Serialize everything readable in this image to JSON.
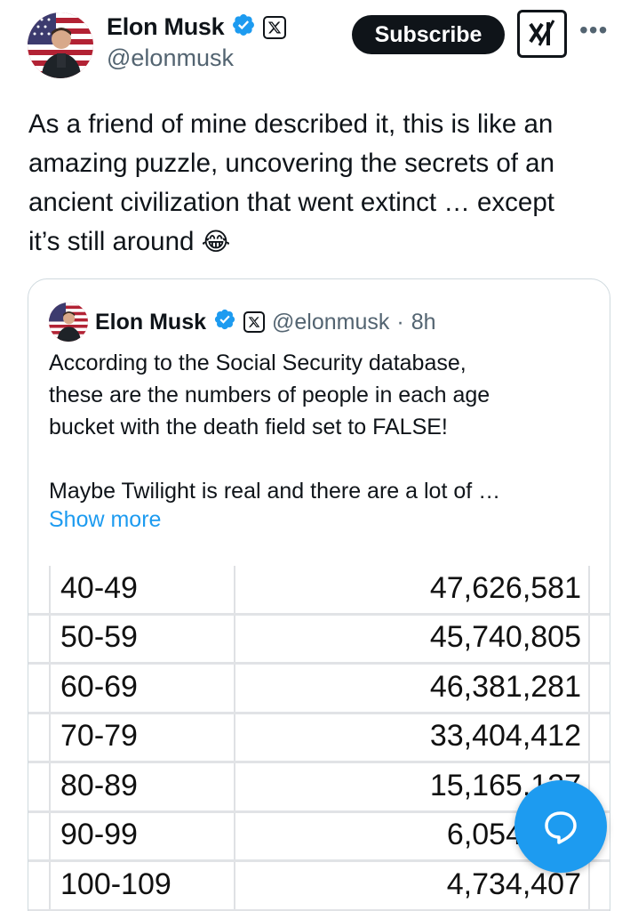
{
  "post": {
    "author_name": "Elon Musk",
    "handle": "@elonmusk",
    "subscribe_label": "Subscribe",
    "more_icon": "more-horizontal-icon",
    "grok_icon": "grok-icon",
    "text_lines": [
      "As a friend of mine described it, this is like an",
      "amazing puzzle, uncovering the secrets of an",
      "ancient civilization that went extinct … except",
      "it’s still around"
    ],
    "emoji": "😂"
  },
  "quote": {
    "author_name": "Elon Musk",
    "handle": "@elonmusk",
    "separator": "·",
    "time": "8h",
    "text_lines": [
      "According to the Social Security database,",
      "these are the numbers of people in each age",
      "bucket with the death field set to FALSE!"
    ],
    "text_line_2": "Maybe Twilight is real and there are a lot of …",
    "show_more": "Show more",
    "table_rows": [
      {
        "age": "40-49",
        "count": "47,626,581"
      },
      {
        "age": "50-59",
        "count": "45,740,805"
      },
      {
        "age": "60-69",
        "count": "46,381,281"
      },
      {
        "age": "70-79",
        "count": "33,404,412"
      },
      {
        "age": "80-89",
        "count": "15,165,127"
      },
      {
        "age": "90-99",
        "count": "6,054"
      },
      {
        "age": "100-109",
        "count": "4,734,407"
      }
    ]
  },
  "colors": {
    "accent": "#1d9bf0",
    "text": "#0f1419",
    "muted": "#536471",
    "border": "#cfd9de"
  },
  "fab": {
    "icon": "chat-bubble-icon"
  }
}
